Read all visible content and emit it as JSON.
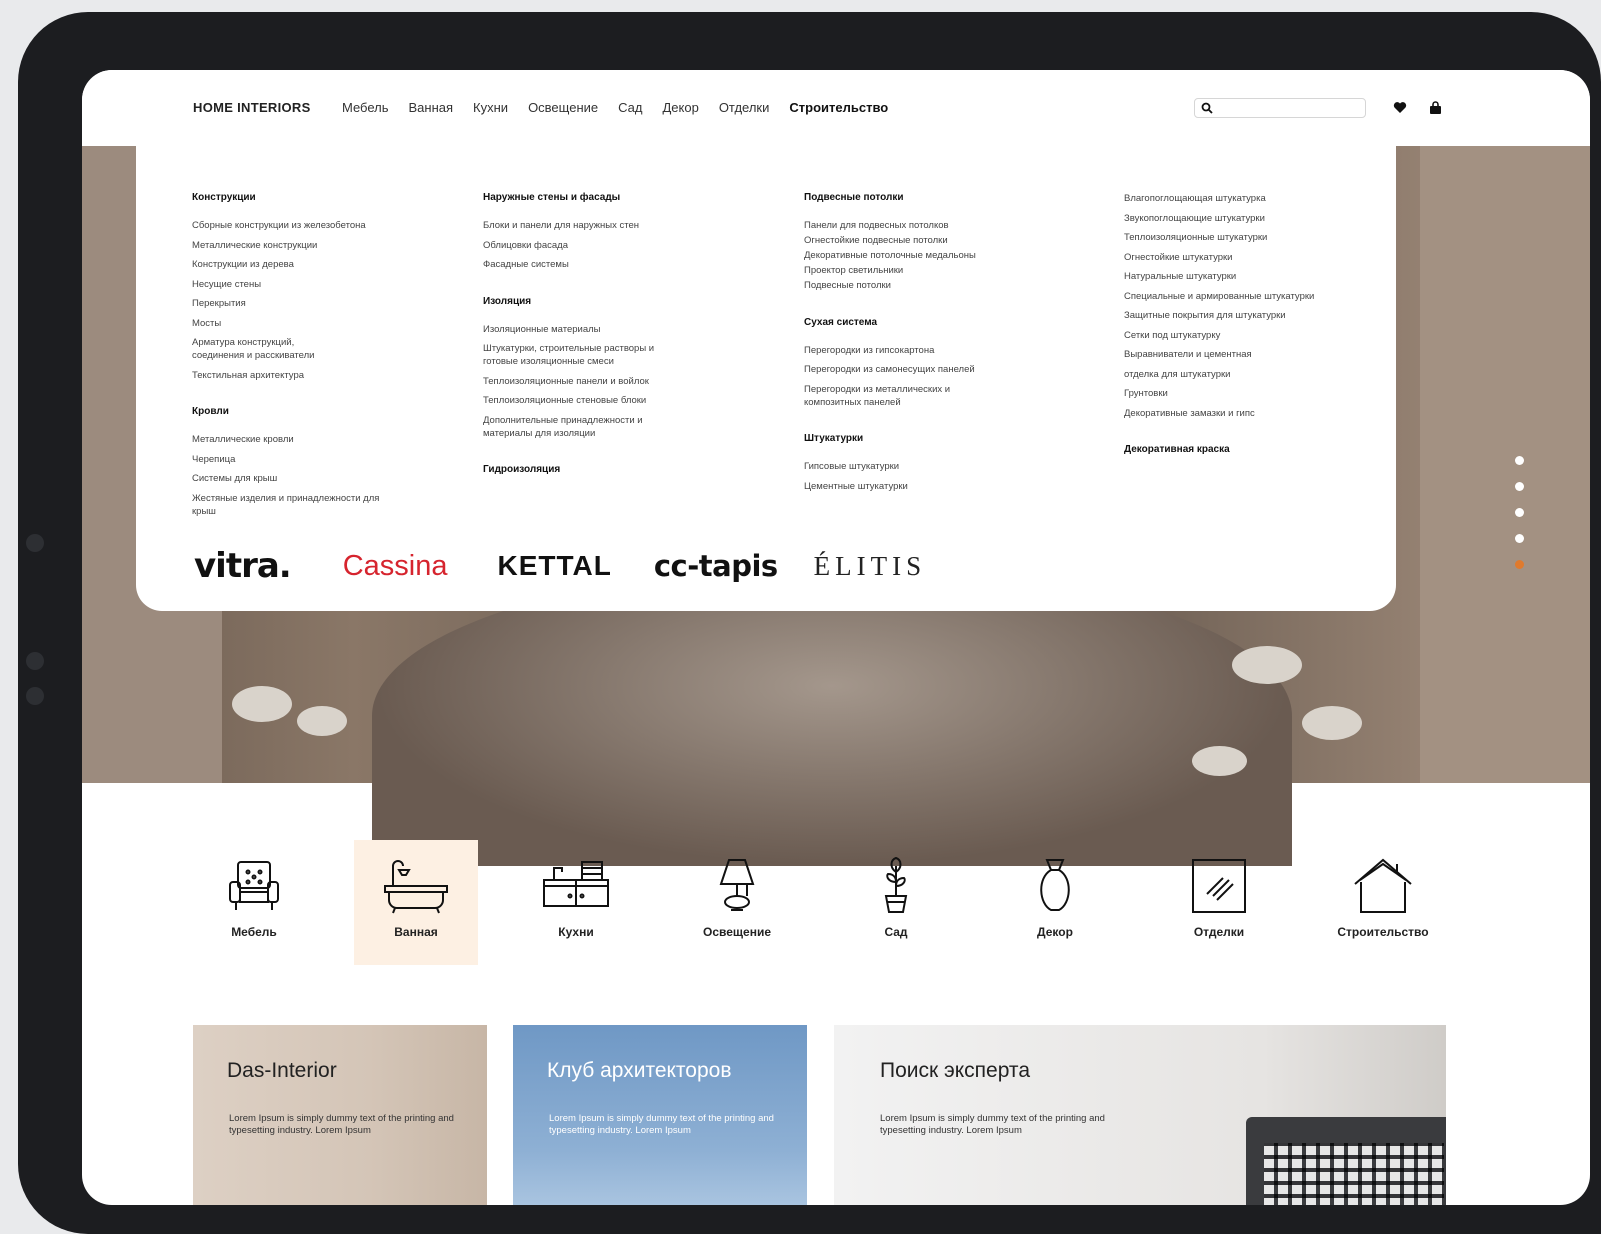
{
  "header": {
    "logo": "HOME INTERIORS",
    "nav": [
      "Мебель",
      "Ванная",
      "Кухни",
      "Освещение",
      "Сад",
      "Декор",
      "Отделки",
      "Строительство"
    ],
    "active_nav": "Строительство",
    "search_placeholder": ""
  },
  "mega_menu": {
    "col1": {
      "heading1": "Конструкции",
      "items1": [
        "Сборные конструкции из железобетона",
        "Металлические конструкции",
        "Конструкции из дерева",
        "Несущие стены",
        "Перекрытия",
        "Мосты",
        "Арматура конструкций, соединения и расскиватели",
        "Текстильная архитектура"
      ],
      "heading2": "Кровли",
      "items2": [
        "Металлические кровли",
        "Черепица",
        "Системы для крыш",
        "Жестяные изделия и принадлежности для крыш"
      ]
    },
    "col2": {
      "heading1": "Наружные стены и фасады",
      "items1": [
        "Блоки и панели для наружных стен",
        "Облицовки фасада",
        "Фасадные системы"
      ],
      "heading2": "Изоляция",
      "items2": [
        "Изоляционные материалы",
        "Штукатурки, строительные растворы и готовые изоляционные смеси",
        "Теплоизоляционные панели и войлок",
        "Теплоизоляционные стеновые блоки",
        "Дополнительные принадлежности и материалы для изоляции"
      ],
      "heading3": "Гидроизоляция"
    },
    "col3": {
      "heading1": "Подвесные потолки",
      "items1": [
        "Панели для подвесных потолков",
        "Огнестойкие подвесные потолки",
        "Декоративные потолочные медальоны",
        "Проектор светильники",
        "Подвесные потолки"
      ],
      "heading2": "Сухая система",
      "items2": [
        "Перегородки из гипсокартона",
        "Перегородки из самонесущих панелей",
        "Перегородки из металлических и композитных панелей"
      ],
      "heading3": "Штукатурки",
      "items3": [
        "Гипсовые штукатурки",
        "Цементные штукатурки"
      ]
    },
    "col4": {
      "items1": [
        "Влагопоглощающая штукатурка",
        "Звукопоглощающие штукатурки",
        "Теплоизоляционные штукатурки",
        "Огнестойкие штукатурки",
        "Натуральные штукатурки",
        "Специальные и армированные штукатурки",
        "Защитные покрытия для штукатурки",
        "Сетки под штукатурку",
        "Выравниватели и цементная",
        "отделка для штукатурки",
        "Грунтовки",
        "Декоративные замазки и гипс"
      ],
      "heading2": "Декоративная краска"
    },
    "brands": [
      "vitra.",
      "Cassina",
      "KETTAL",
      "cc-tapis",
      "ÉLITIS"
    ]
  },
  "slider": {
    "count": 5,
    "active_index": 4,
    "accent": "#e07a2d"
  },
  "categories": [
    {
      "label": "Мебель",
      "icon": "armchair-icon"
    },
    {
      "label": "Ванная",
      "icon": "bathtub-icon"
    },
    {
      "label": "Кухни",
      "icon": "kitchen-icon"
    },
    {
      "label": "Освещение",
      "icon": "lamp-icon"
    },
    {
      "label": "Сад",
      "icon": "plant-icon"
    },
    {
      "label": "Декор",
      "icon": "vase-icon"
    },
    {
      "label": "Отделки",
      "icon": "finish-tile-icon"
    },
    {
      "label": "Строительство",
      "icon": "house-icon"
    }
  ],
  "active_category": "Ванная",
  "cards": [
    {
      "title": "Das-Interior",
      "text": "Lorem Ipsum is simply dummy text of the printing and typesetting industry. Lorem Ipsum"
    },
    {
      "title": "Клуб архитекторов",
      "text": "Lorem Ipsum is simply dummy text of the printing and typesetting industry. Lorem Ipsum"
    },
    {
      "title": "Поиск эксперта",
      "text": "Lorem Ipsum is simply dummy text of the printing and typesetting industry. Lorem Ipsum"
    }
  ]
}
